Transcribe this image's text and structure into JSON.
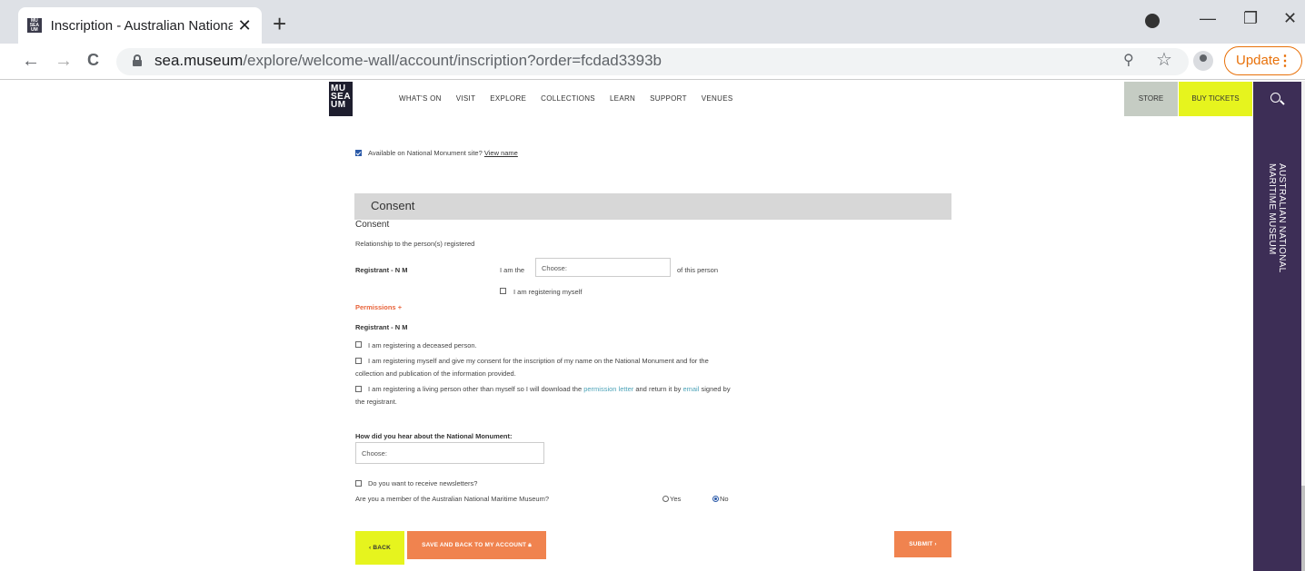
{
  "browser": {
    "tab_title": "Inscription - Australian National M",
    "favicon_text": "MU SEA UM",
    "tab_close": "✕",
    "new_tab": "+",
    "url_host": "sea.museum",
    "url_path": "/explore/welcome-wall/account/inscription?order=fcdad3393b",
    "update_label": "Update",
    "nav": {
      "back": "←",
      "forward": "→",
      "reload": "C"
    }
  },
  "site": {
    "logo_lines": [
      "MU",
      "SEA",
      "UM"
    ],
    "nav_items": [
      "WHAT'S ON",
      "VISIT",
      "EXPLORE",
      "COLLECTIONS",
      "LEARN",
      "SUPPORT",
      "VENUES"
    ],
    "store_label": "STORE",
    "tickets_label": "BUY TICKETS",
    "side_title_line1": "AUSTRALIAN NATIONAL",
    "side_title_line2": "MARITIME MUSEUM"
  },
  "form": {
    "available_label": "Available on National Monument site?",
    "view_name_link": "View name",
    "available_checked": true,
    "section_title": "Consent",
    "consent_heading": "Consent",
    "relationship_label": "Relationship to the person(s) registered",
    "registrant_label": "Registrant - N M",
    "i_am_the": "I am the",
    "relationship_select_value": "Choose:",
    "of_this_person": "of this person",
    "registering_myself": "I am registering myself",
    "permissions_label": "Permissions +",
    "perm_registrant_label": "Registrant - N M",
    "perm_deceased": "I am registering a deceased person.",
    "perm_myself_line1": "I am registering myself and give my consent for the inscription of my name on the National Monument and for the",
    "perm_myself_line2": "collection and publication of the information provided.",
    "perm_living_part1": "I am registering a living person other than myself so I will download the",
    "perm_living_link1": "permission letter",
    "perm_living_part2": "and return it by",
    "perm_living_link2": "email",
    "perm_living_part3": "signed by",
    "perm_living_line2": "the registrant.",
    "hear_label": "How did you hear about the National Monument:",
    "hear_select_value": "Choose:",
    "newsletter_label": "Do you want to receive newsletters?",
    "member_question": "Are you a member of the Australian National Maritime Museum?",
    "member_yes": "Yes",
    "member_no": "No",
    "member_selected": "No"
  },
  "buttons": {
    "back": "‹ BACK",
    "save": "SAVE AND BACK TO MY ACCOUNT",
    "submit": "SUBMIT ›"
  }
}
